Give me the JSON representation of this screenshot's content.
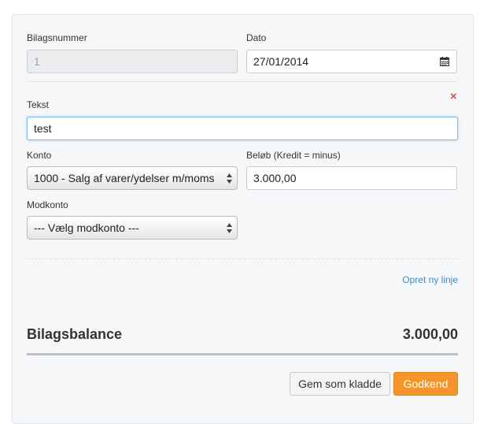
{
  "form": {
    "bilagsnummer": {
      "label": "Bilagsnummer",
      "value": "1"
    },
    "dato": {
      "label": "Dato",
      "value": "27/01/2014"
    },
    "tekst": {
      "label": "Tekst",
      "value": "test"
    },
    "konto": {
      "label": "Konto",
      "selected": "1000 - Salg af varer/ydelser m/moms"
    },
    "beloeb": {
      "label": "Beløb (Kredit = minus)",
      "value": "3.000,00"
    },
    "modkonto": {
      "label": "Modkonto",
      "selected": "--- Vælg modkonto ---"
    },
    "remove_glyph": "×",
    "new_line_link": "Opret ny linje"
  },
  "balance": {
    "label": "Bilagsbalance",
    "value": "3.000,00"
  },
  "actions": {
    "draft_label": "Gem som kladde",
    "approve_label": "Godkend"
  },
  "colors": {
    "primary": "#f4952b",
    "link": "#3a8bc8",
    "remove": "#d9534f"
  },
  "icons": {
    "calendar": "calendar-icon",
    "remove": "close-icon",
    "select": "updown-arrows-icon"
  }
}
